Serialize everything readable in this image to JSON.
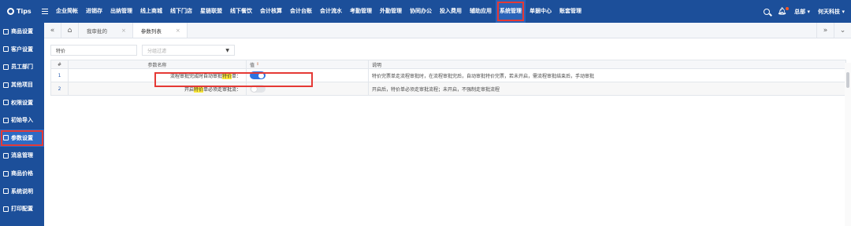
{
  "app": {
    "brand": "Tips"
  },
  "topnav": {
    "items": [
      "企业简帐",
      "进销存",
      "出纳管理",
      "线上商城",
      "线下门店",
      "星链联盟",
      "线下餐饮",
      "会计核算",
      "会计台账",
      "会计流水",
      "考勤管理",
      "外勤管理",
      "协同办公",
      "投入费用",
      "辅助应用",
      "系统管理",
      "单据中心",
      "账套管理"
    ],
    "active": "系统管理",
    "user_menu": "总部",
    "company_menu": "何天科技"
  },
  "sidebar": {
    "items": [
      {
        "label": "商品设置"
      },
      {
        "label": "客户设置"
      },
      {
        "label": "员工部门"
      },
      {
        "label": "其他项目"
      },
      {
        "label": "权限设置"
      },
      {
        "label": "初始导入"
      },
      {
        "label": "参数设置",
        "active": true
      },
      {
        "label": "消息管理"
      },
      {
        "label": "商品价格"
      },
      {
        "label": "系统说明"
      },
      {
        "label": "打印配置"
      }
    ]
  },
  "tabs": {
    "items": [
      {
        "label": "我审批的"
      },
      {
        "label": "参数列表",
        "active": true
      }
    ]
  },
  "filters": {
    "keyword_value": "特价",
    "group_placeholder": "分组过滤"
  },
  "table": {
    "headers": {
      "idx": "#",
      "name": "参数名称",
      "value": "值",
      "desc": "说明"
    },
    "rows": [
      {
        "idx": "1",
        "name_pre": "流程审批完成时自动审批",
        "name_hl": "特价",
        "name_post": "单：",
        "enabled": true,
        "desc": "特价完票单走流程审批时，在流程审批完后，自动审批特价完票，若未开启，需流程审批结束后，手动审批"
      },
      {
        "idx": "2",
        "name_pre": "开启",
        "name_hl": "特价",
        "name_post": "单必须走审批流：",
        "enabled": false,
        "desc": "开启后，特价单必须走审批流程；未开启，不强制走审批流程"
      }
    ]
  },
  "colors": {
    "nav_bg": "#1c4f9a",
    "highlight_border": "#e53935",
    "toggle_on": "#2f73e0",
    "keyword_highlight": "#ffeb3b"
  }
}
